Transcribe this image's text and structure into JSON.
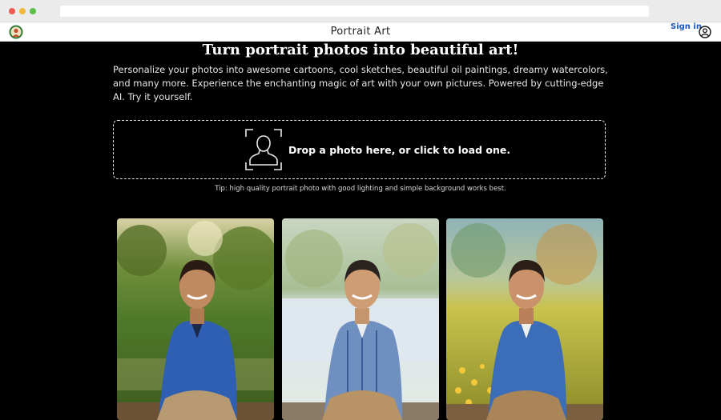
{
  "app": {
    "title": "Portrait Art",
    "sign_in_label": "Sign in"
  },
  "icons": {
    "logo": "app-logo-icon",
    "account": "account-circle-icon",
    "upload": "portrait-frame-icon"
  },
  "hero": {
    "title": "Turn portrait photos into beautiful art!",
    "description": "Personalize your photos into awesome cartoons, cool sketches, beautiful oil paintings, dreamy watercolors, and many more. Experience the enchanting magic of art with your own pictures. Powered by cutting-edge AI. Try it yourself."
  },
  "upload": {
    "prompt": "Drop a photo here, or click to load one.",
    "tip": "Tip: high quality portrait photo with good lighting and simple background works best."
  },
  "gallery": [
    {
      "style": "photo"
    },
    {
      "style": "watercolor"
    },
    {
      "style": "oil-painting"
    }
  ],
  "colors": {
    "background": "#000000",
    "link": "#1a56c4"
  }
}
